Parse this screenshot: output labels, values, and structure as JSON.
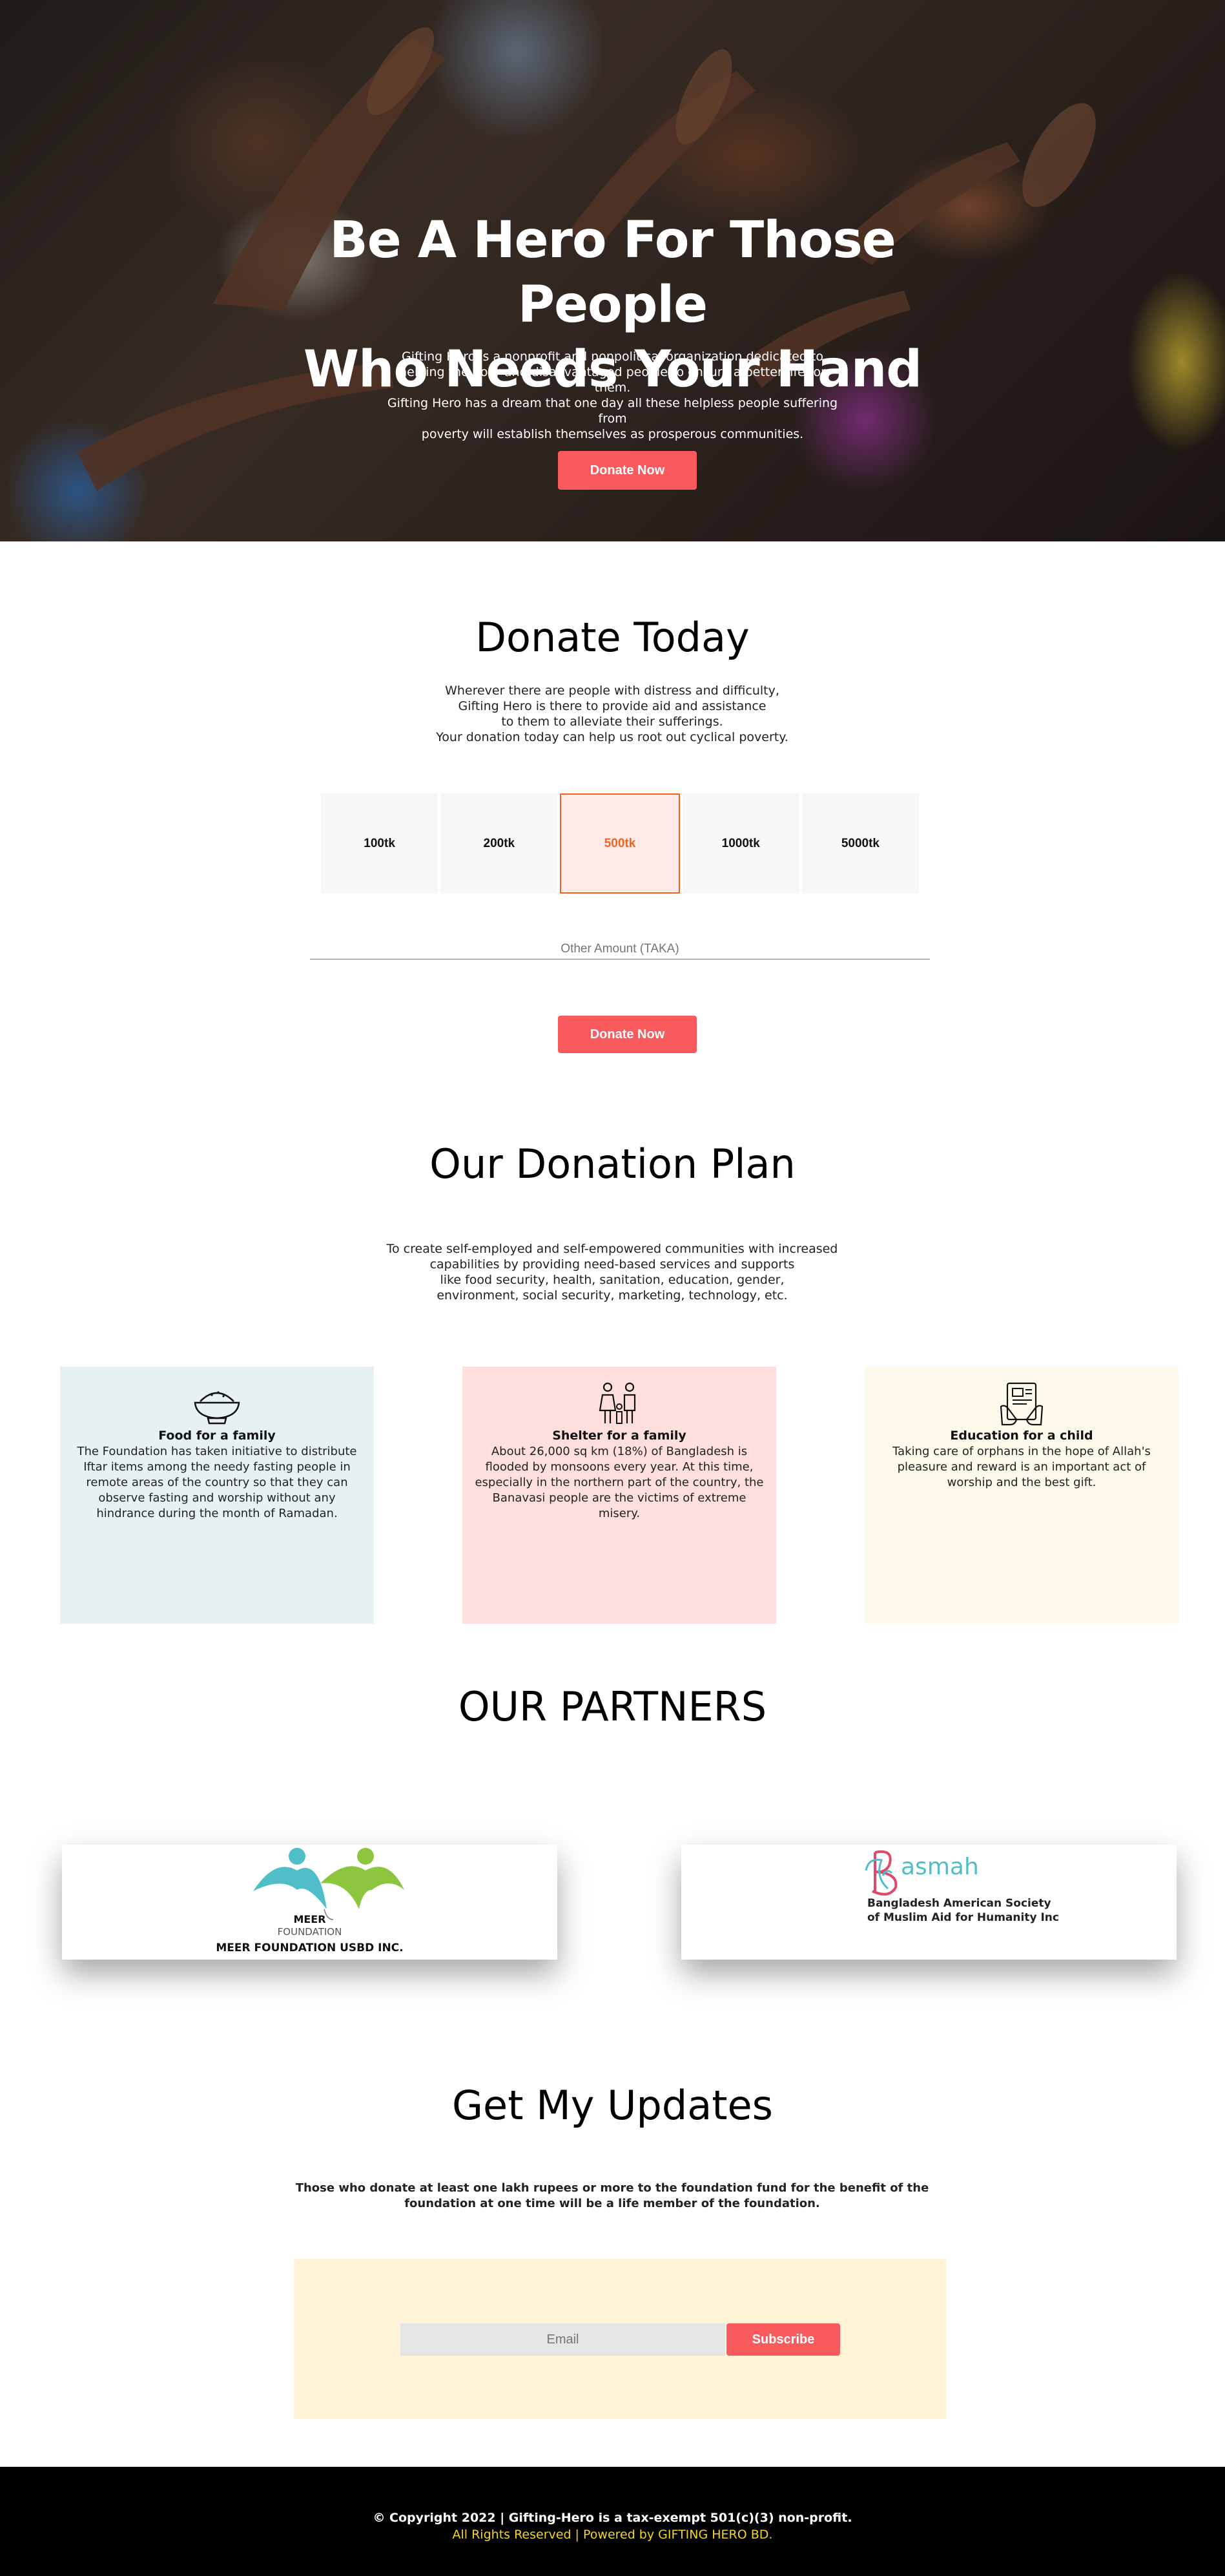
{
  "hero": {
    "title_line1": "Be A Hero For Those People",
    "title_line2": "Who Needs Your Hand",
    "text_lines": [
      "Gifting Hero is a nonprofit and nonpolitical organization dedicated to",
      "helping the poor and disadvantaged people to ensure a better life for them.",
      "Gifting Hero has a dream that one day all these helpless people suffering from",
      "poverty will establish themselves as prosperous communities."
    ],
    "donate_label": "Donate Now"
  },
  "donate": {
    "title": "Donate Today",
    "text_lines": [
      "Wherever there are people with distress and difficulty,",
      "Gifting Hero is there to provide aid and assistance",
      "to them to alleviate their sufferings.",
      "Your donation today can help us root out cyclical poverty."
    ],
    "amounts": [
      "100tk",
      "200tk",
      "500tk",
      "1000tk",
      "5000tk"
    ],
    "selected_amount": "500tk",
    "other_placeholder": "Other Amount (TAKA)",
    "donate_label": "Donate Now"
  },
  "plan": {
    "title": "Our Donation Plan",
    "text_lines": [
      "To create self-employed and self-empowered communities with increased",
      "capabilities by providing need-based services and supports",
      "like food security, health, sanitation, education, gender,",
      "environment, social security, marketing, technology, etc."
    ],
    "cards": [
      {
        "icon": "rice-bowl-icon",
        "title": "Food for a family",
        "text": "The Foundation has taken initiative to distribute Iftar items among the needy fasting people in remote areas of the country so that they can observe fasting and worship without any hindrance during the month of Ramadan.",
        "bg": "#e8f1f2"
      },
      {
        "icon": "family-icon",
        "title": "Shelter for a family",
        "text": "About 26,000 sq km (18%) of Bangladesh is flooded by monsoons every year. At this time, especially in the northern part of the country, the Banavasi people are the victims of extreme misery.",
        "bg": "#ffdede"
      },
      {
        "icon": "tablet-education-icon",
        "title": "Education for a child",
        "text": "Taking care of orphans in the hope of Allah's pleasure and reward is an important act of worship and the best gift.",
        "bg": "#fef9ea"
      }
    ]
  },
  "partners": {
    "title": "OUR PARTNERS",
    "items": [
      {
        "logo_word1": "MEER",
        "logo_word2": "FOUNDATION",
        "name": "MEER FOUNDATION USBD INC."
      },
      {
        "logo_word": "asmah",
        "name_line1": "Bangladesh American Society",
        "name_line2": "of Muslim Aid for Humanity Inc"
      }
    ]
  },
  "updates": {
    "title": "Get My Updates",
    "text_line1": "Those who donate at least one lakh rupees or more to the foundation fund for the benefit of the",
    "text_line2": "foundation at one time will be a life member of the foundation.",
    "email_placeholder": "Email",
    "subscribe_label": "Subscribe"
  },
  "footer": {
    "line1": "© Copyright 2022 | Gifting-Hero is a tax-exempt 501(c)(3) non-profit.",
    "line2": "All Rights Reserved | Powered by GIFTING HERO BD."
  },
  "colors": {
    "accent": "#f85a5e",
    "selected": "#f06420",
    "footer_highlight": "#f4d520"
  }
}
